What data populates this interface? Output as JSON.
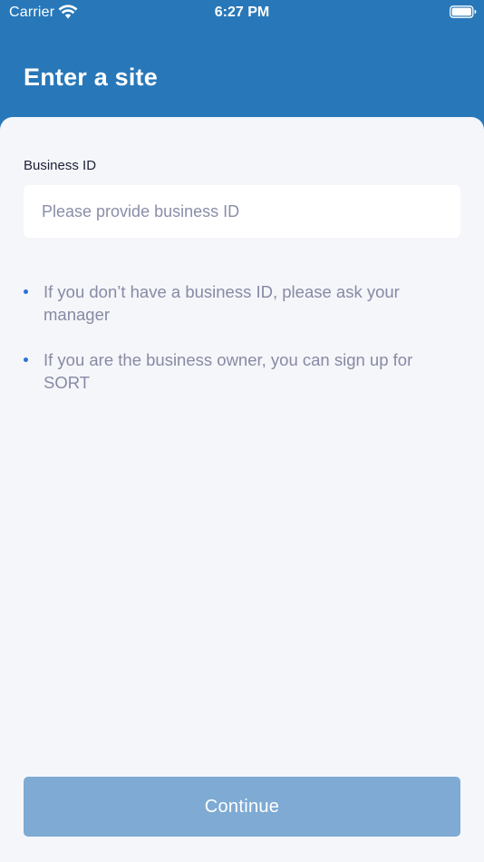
{
  "status_bar": {
    "carrier": "Carrier",
    "time": "6:27 PM"
  },
  "header": {
    "title": "Enter a site"
  },
  "form": {
    "business_id_label": "Business ID",
    "business_id_value": "",
    "business_id_placeholder": "Please provide business ID"
  },
  "hints": [
    "If you don’t have a business ID, please ask your manager",
    "If you are the business owner, you can sign up for SORT"
  ],
  "footer": {
    "continue_label": "Continue"
  },
  "colors": {
    "header_bg": "#2878b9",
    "sheet_bg": "#f5f6fa",
    "bullet": "#2a72d8",
    "button_disabled": "#7eaad3"
  },
  "icons": {
    "signal": "wifi-icon",
    "battery": "battery-icon"
  }
}
